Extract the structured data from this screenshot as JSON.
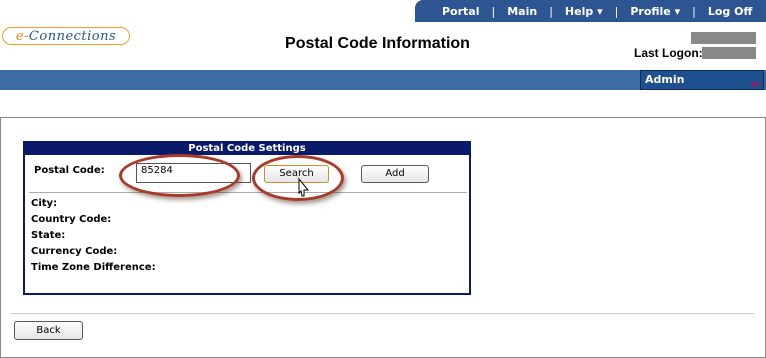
{
  "nav": {
    "items": [
      "Portal",
      "Main",
      "Help",
      "Profile",
      "Log Off"
    ],
    "separator": "|",
    "dropdown_arrow": "▾"
  },
  "logo": {
    "prefix": "e-",
    "text": "Connections"
  },
  "header": {
    "title": "Postal Code Information",
    "last_logon_label": "Last Logon:"
  },
  "role_select": {
    "value": "Admin"
  },
  "panel": {
    "title": "Postal Code Settings",
    "postal_code_label": "Postal Code:",
    "postal_code_value": "85284",
    "search_label": "Search",
    "add_label": "Add",
    "fields": [
      "City:",
      "Country Code:",
      "State:",
      "Currency Code:",
      "Time Zone Difference:"
    ]
  },
  "footer": {
    "back_label": "Back"
  },
  "colors": {
    "nav_bg": "#2c5591",
    "banner": "#3d6ba3",
    "panel_border": "#0a1a6a",
    "annotation_ring": "#a83a2a"
  }
}
